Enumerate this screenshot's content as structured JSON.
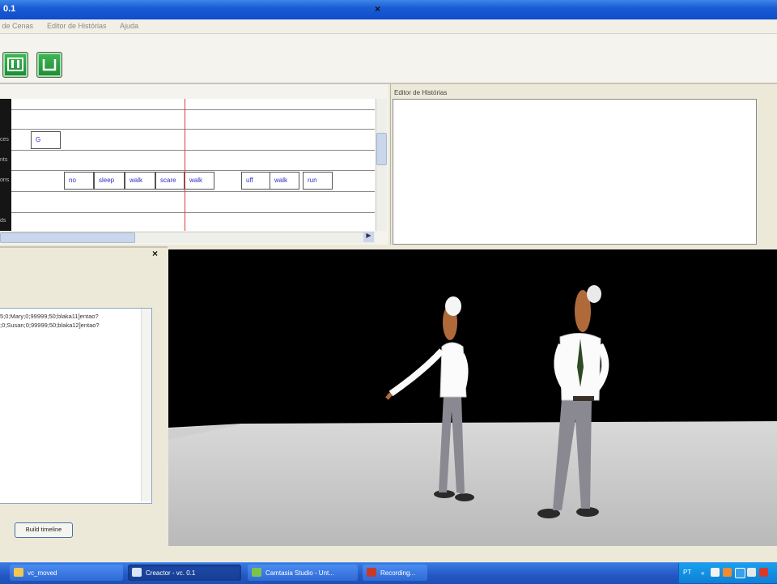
{
  "window": {
    "title": "0.1"
  },
  "menu": [
    "r de Cenas",
    "Editor de Histórias",
    "Ajuda"
  ],
  "toolbar": {
    "buttons": [
      "play-pause-icon",
      "stop-icon"
    ]
  },
  "timeline": {
    "close_label": "×",
    "rows": [
      {
        "label": ""
      },
      {
        "label": ""
      },
      {
        "label": "ces"
      },
      {
        "label": "nts"
      },
      {
        "label": "ons"
      },
      {
        "label": ""
      },
      {
        "label": "ds"
      }
    ],
    "clips": [
      {
        "text": "G"
      },
      {
        "text": "no"
      },
      {
        "text": "sleep"
      },
      {
        "text": "walk"
      },
      {
        "text": "scare"
      },
      {
        "text": "walk"
      },
      {
        "text": "uff"
      },
      {
        "text": "walk"
      },
      {
        "text": "run"
      }
    ],
    "scroll_up": "▲",
    "scroll_down": "▼",
    "scroll_right": "▶"
  },
  "story_editor": {
    "label": "Editor de Histórias"
  },
  "script_panel": {
    "close_label": "×",
    "lines": [
      "5;0;Mary;0;99999;50;blaka11]entao?",
      ";0;Susan;0;99999;50;blaka12]entao?"
    ],
    "build_button": "Build timeline"
  },
  "taskbar": {
    "tasks": [
      {
        "label": "vc_moved",
        "active": false
      },
      {
        "label": "Creactor - vc. 0.1",
        "active": true
      },
      {
        "label": "Camtasia Studio - Unt...",
        "active": false
      },
      {
        "label": "Recording...",
        "active": false
      }
    ],
    "tray_text": "PT"
  },
  "colors": {
    "title_blue": "#1b5cd3",
    "playhead_red": "#e23b3b",
    "clip_text_blue": "#2d2dcc",
    "toolbar_green": "#1c8a33",
    "viewport_black": "#000000",
    "floor_gray": "#c9c9c9"
  }
}
